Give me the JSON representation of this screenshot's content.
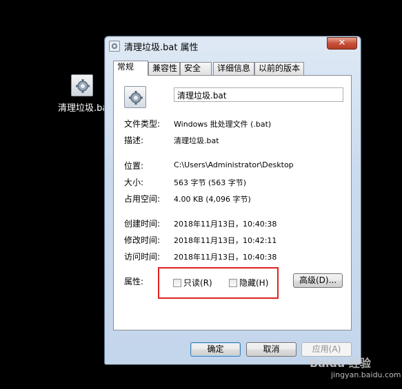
{
  "desktop": {
    "icon_label": "清理垃圾.bat",
    "icon_name": "batch-file-gear-icon"
  },
  "window": {
    "title": "清理垃圾.bat 属性",
    "close_symbol": "✕",
    "tabs": [
      "常规",
      "兼容性",
      "安全",
      "详细信息",
      "以前的版本"
    ],
    "active_tab": "常规"
  },
  "general": {
    "filename": "清理垃圾.bat",
    "rows": [
      {
        "label": "文件类型:",
        "value": "Windows 批处理文件 (.bat)"
      },
      {
        "label": "描述:",
        "value": "清理垃圾.bat"
      },
      {
        "label": "位置:",
        "value": "C:\\Users\\Administrator\\Desktop"
      },
      {
        "label": "大小:",
        "value": "563 字节 (563 字节)"
      },
      {
        "label": "占用空间:",
        "value": "4.00 KB (4,096 字节)"
      },
      {
        "label": "创建时间:",
        "value": "2018年11月13日，10:40:38"
      },
      {
        "label": "修改时间:",
        "value": "2018年11月13日，10:42:11"
      },
      {
        "label": "访问时间:",
        "value": "2018年11月13日，10:40:38"
      }
    ],
    "attributes_label": "属性:",
    "readonly_label": "只读(R)",
    "hidden_label": "隐藏(H)",
    "readonly_checked": false,
    "hidden_checked": false,
    "advanced_button": "高级(D)..."
  },
  "buttons": {
    "ok": "确定",
    "cancel": "取消",
    "apply": "应用(A)"
  },
  "watermark": {
    "brand": "Baidu 经验",
    "url": "jingyan.baidu.com"
  },
  "colors": {
    "highlight_box": "#e02020",
    "close_button": "#c7513b"
  }
}
